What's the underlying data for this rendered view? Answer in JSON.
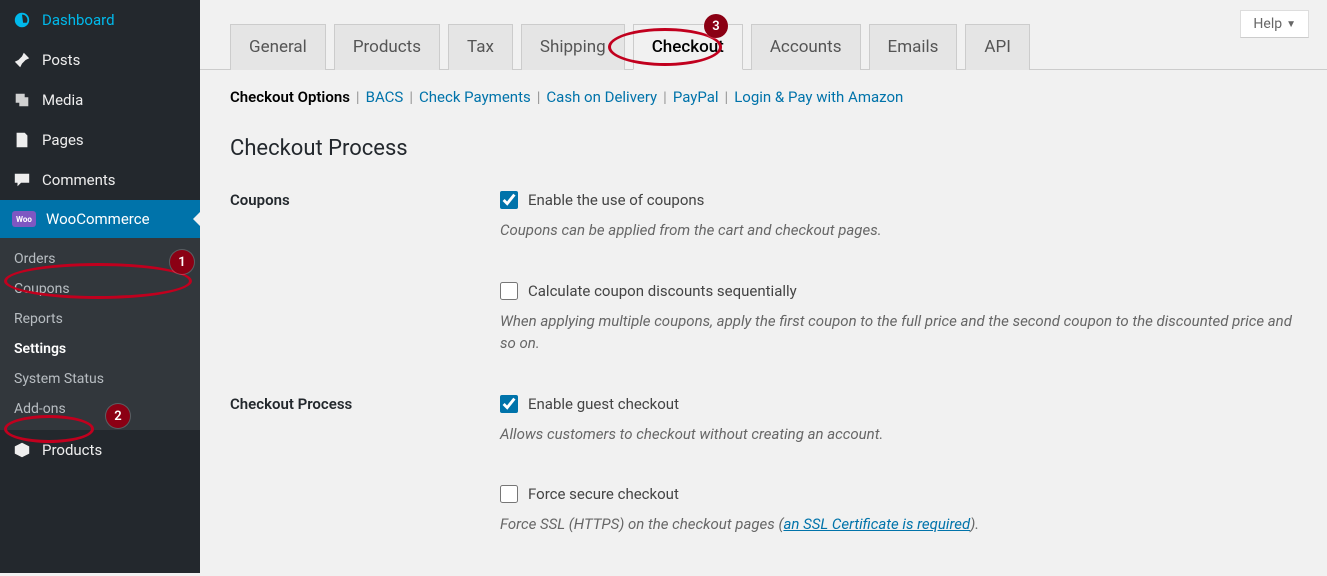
{
  "help_label": "Help",
  "sidebar": {
    "dashboard": "Dashboard",
    "posts": "Posts",
    "media": "Media",
    "pages": "Pages",
    "comments": "Comments",
    "woocommerce": "WooCommerce",
    "woo_badge": "Woo",
    "submenu": {
      "orders": "Orders",
      "coupons": "Coupons",
      "reports": "Reports",
      "settings": "Settings",
      "system_status": "System Status",
      "addons": "Add-ons"
    },
    "products": "Products"
  },
  "annotations": {
    "b1": "1",
    "b2": "2",
    "b3": "3"
  },
  "tabs": {
    "general": "General",
    "products": "Products",
    "tax": "Tax",
    "shipping": "Shipping",
    "checkout": "Checkout",
    "accounts": "Accounts",
    "emails": "Emails",
    "api": "API"
  },
  "subsubsub": {
    "checkout_options": "Checkout Options",
    "bacs": "BACS",
    "check_payments": "Check Payments",
    "cod": "Cash on Delivery",
    "paypal": "PayPal",
    "amazon": "Login & Pay with Amazon"
  },
  "heading": "Checkout Process",
  "form": {
    "coupons_label": "Coupons",
    "enable_coupons_label": "Enable the use of coupons",
    "enable_coupons_desc": "Coupons can be applied from the cart and checkout pages.",
    "calc_seq_label": "Calculate coupon discounts sequentially",
    "calc_seq_desc": "When applying multiple coupons, apply the first coupon to the full price and the second coupon to the discounted price and so on.",
    "checkout_process_label": "Checkout Process",
    "guest_label": "Enable guest checkout",
    "guest_desc": "Allows customers to checkout without creating an account.",
    "force_ssl_label": "Force secure checkout",
    "force_ssl_desc_pre": "Force SSL (HTTPS) on the checkout pages (",
    "force_ssl_link": "an SSL Certificate is required",
    "force_ssl_desc_post": ")."
  }
}
